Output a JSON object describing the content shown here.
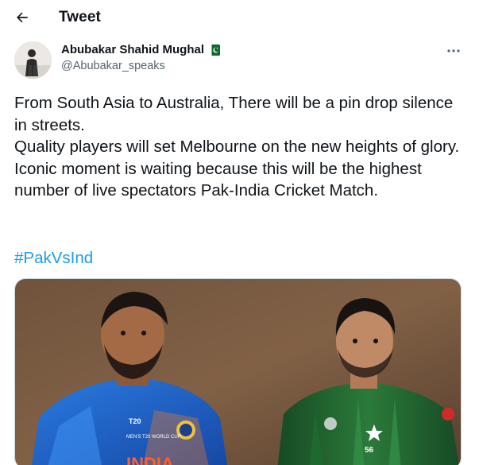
{
  "header": {
    "title": "Tweet",
    "back_icon": "back-arrow-icon"
  },
  "author": {
    "name": "Abubakar Shahid Mughal",
    "handle": "@Abubakar_speaks",
    "badge_icon": "pakistan-flag-icon",
    "more_icon": "more-options-icon"
  },
  "tweet": {
    "text": "From South Asia to Australia, There will be a pin drop silence in streets.\nQuality players will set Melbourne on the new heights of glory. Iconic moment is waiting because this will be the highest number of live spectators Pak-India Cricket Match.",
    "hashtag": "#PakVsInd"
  },
  "media": {
    "badge_left": "INDIA",
    "badge_left_sub": "MEN'S T20 WORLD CUP",
    "number_right": "56"
  },
  "colors": {
    "link": "#1d9bf0",
    "text": "#0f1419",
    "secondary": "#536471",
    "india_blue": "#1f64c8",
    "pakistan_green": "#1d5b2a"
  }
}
